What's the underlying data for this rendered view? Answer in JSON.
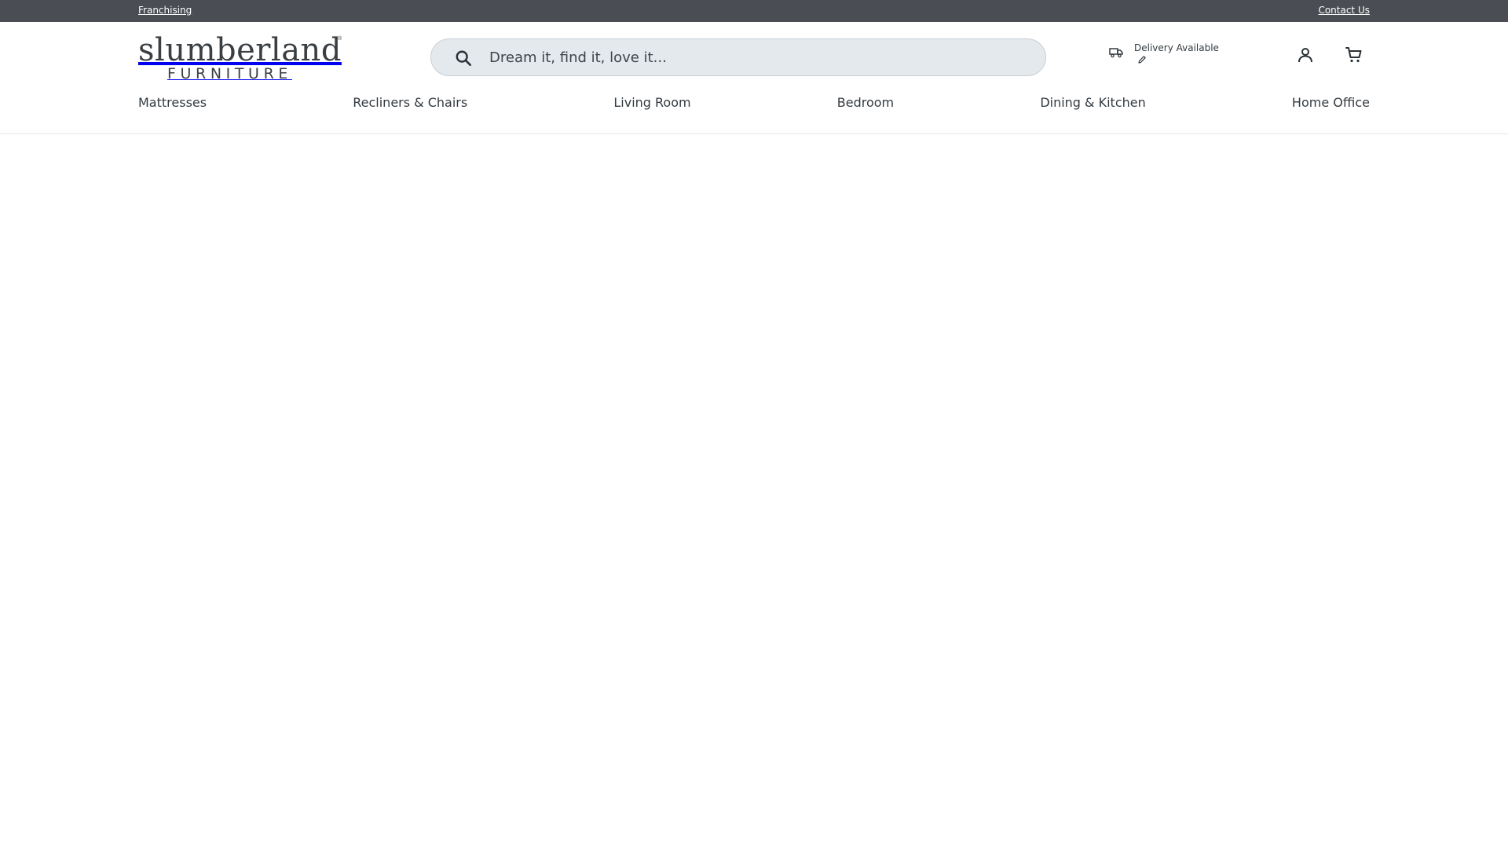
{
  "utility_bar": {
    "left_link": "Franchising",
    "right_link": "Contact Us",
    "background": "#4a4e54"
  },
  "logo": {
    "wordmark": "slumberland",
    "subword": "FURNITURE",
    "registered_mark": "®"
  },
  "search": {
    "placeholder": "Dream it, find it, love it...",
    "value": "",
    "icon": "search-icon"
  },
  "delivery": {
    "label": "Delivery Available",
    "icon": "truck-icon",
    "edit_icon": "pencil-icon"
  },
  "header_icons": {
    "account": "account-icon",
    "cart": "cart-icon"
  },
  "nav": {
    "items": [
      {
        "label": "Mattresses"
      },
      {
        "label": "Recliners & Chairs"
      },
      {
        "label": "Living Room"
      },
      {
        "label": "Bedroom"
      },
      {
        "label": "Dining & Kitchen"
      },
      {
        "label": "Home Office"
      }
    ]
  }
}
